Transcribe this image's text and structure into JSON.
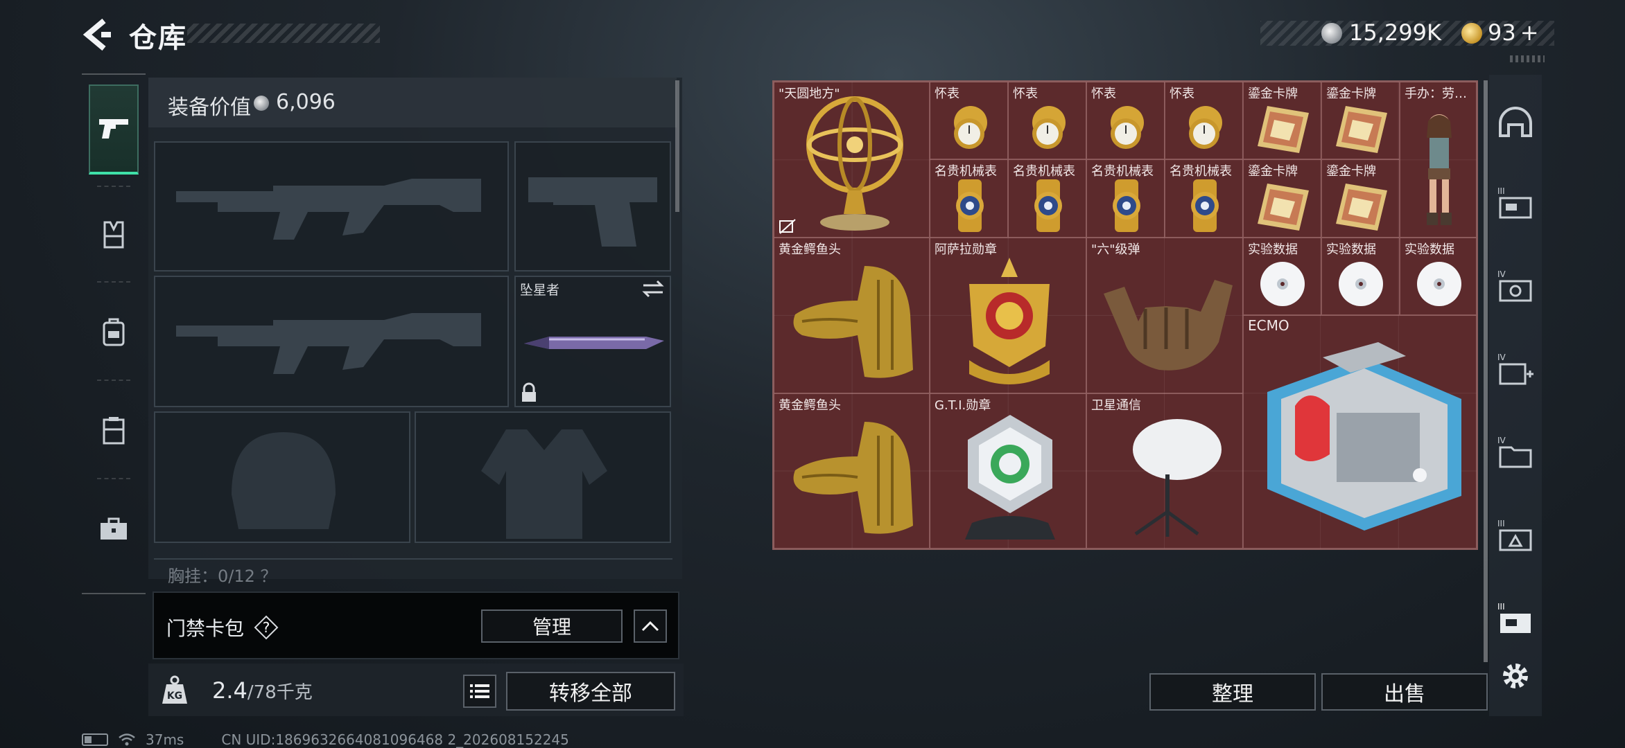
{
  "header": {
    "title": "仓库",
    "silver_amount": "15,299K",
    "gold_amount": "93",
    "gold_add_symbol": "+"
  },
  "left_rail": {
    "tabs": [
      {
        "icon": "pistol-icon",
        "active": true
      },
      {
        "icon": "vest-icon",
        "active": false
      },
      {
        "icon": "backpack-icon",
        "active": false
      },
      {
        "icon": "container-icon",
        "active": false
      },
      {
        "icon": "toolbox-icon",
        "active": false
      }
    ]
  },
  "equipment": {
    "label": "装备价值",
    "value": "6,096",
    "slots": {
      "melee_name": "坠星者"
    },
    "chest_label": "胸挂：0/12 ？"
  },
  "keycard": {
    "label": "门禁卡包",
    "help": "?",
    "manage_button": "管理"
  },
  "weight": {
    "current": "2.4",
    "max": "/78",
    "unit": "千克",
    "transfer_button": "转移全部"
  },
  "stash": {
    "items": {
      "armillary": "\"天圆地方\"",
      "watch": "怀表",
      "card": "鎏金卡牌",
      "figure": "手办：劳…",
      "wristwatch": "名贵机械表",
      "croc": "黄金鳄鱼头",
      "medal_asala": "阿萨拉勋章",
      "six": "\"六\"级弹",
      "data": "实验数据",
      "ecmo": "ECMO",
      "medal_gti": "G.T.I.勋章",
      "satellite": "卫星通信"
    },
    "sort_button": "整理",
    "sell_button": "出售"
  },
  "right_rail": {
    "items": [
      "helmet-icon",
      "case-icon-3",
      "case-icon-4",
      "medkit-icon-4",
      "folder-icon-4",
      "pack-icon-3",
      "case-icon-3b",
      "settings-icon"
    ]
  },
  "status": {
    "ping": "37ms",
    "uid": "CN UID:1869632664081096468 2_202608152245"
  },
  "colors": {
    "accent_green": "#3fe0a8",
    "stash_bg": "#5c2a2c",
    "gold": "#d4a72c"
  }
}
